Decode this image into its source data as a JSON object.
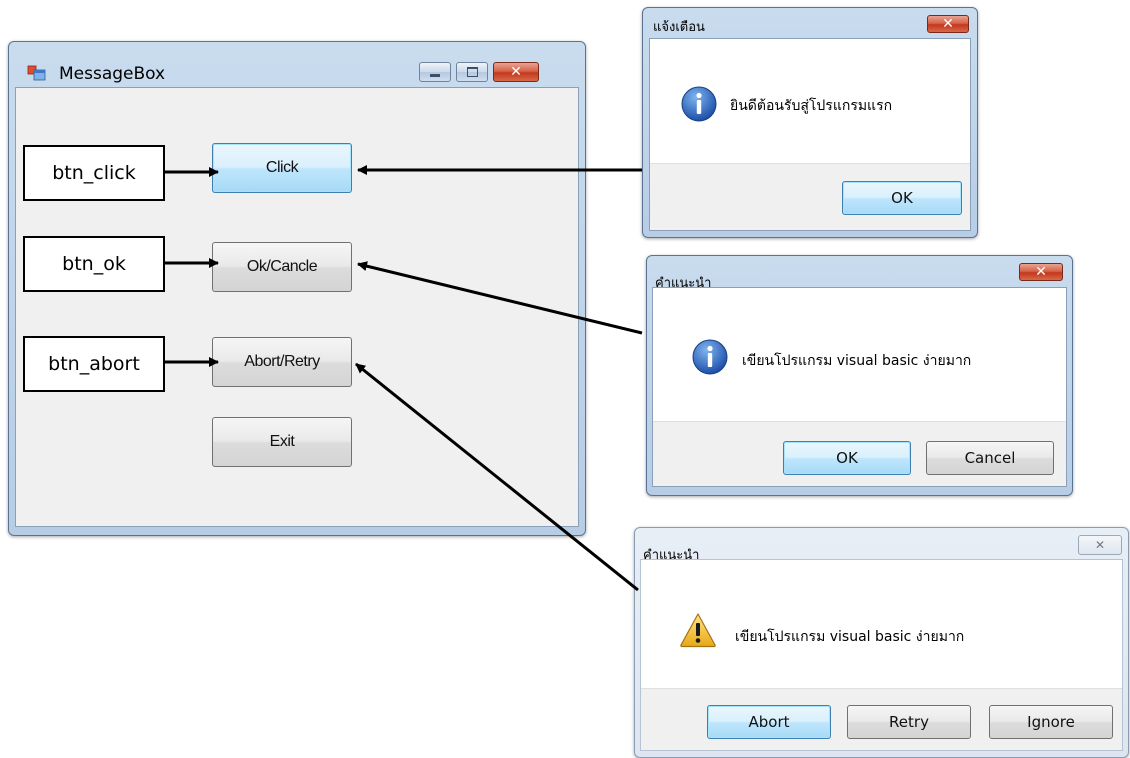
{
  "main_window": {
    "title": "MessageBox",
    "buttons": {
      "click": "Click",
      "ok": "Ok/Cancle",
      "abort": "Abort/Retry",
      "exit": "Exit"
    }
  },
  "labels": {
    "btn_click": "btn_click",
    "btn_ok": "btn_ok",
    "btn_abort": "btn_abort"
  },
  "dialog_info": {
    "title": "แจ้งเตือน",
    "message": "ยินดีต้อนรับสู่โปรแกรมแรก",
    "icon": "information-icon",
    "ok": "OK"
  },
  "dialog_okcancel": {
    "title": "คำแนะนำ",
    "message": "เขียนโปรแกรม visual basic ง่ายมาก",
    "icon": "information-icon",
    "ok": "OK",
    "cancel": "Cancel"
  },
  "dialog_abort": {
    "title": "คำแนะนำ",
    "message": "เขียนโปรแกรม visual basic ง่ายมาก",
    "icon": "warning-icon",
    "abort": "Abort",
    "retry": "Retry",
    "ignore": "Ignore"
  },
  "colors": {
    "frame": "#b7cde6",
    "close_button": "#c3381c",
    "focus_border": "#3c7fb1",
    "info_icon": "#2a66c2",
    "warning_icon": "#f2c230"
  }
}
